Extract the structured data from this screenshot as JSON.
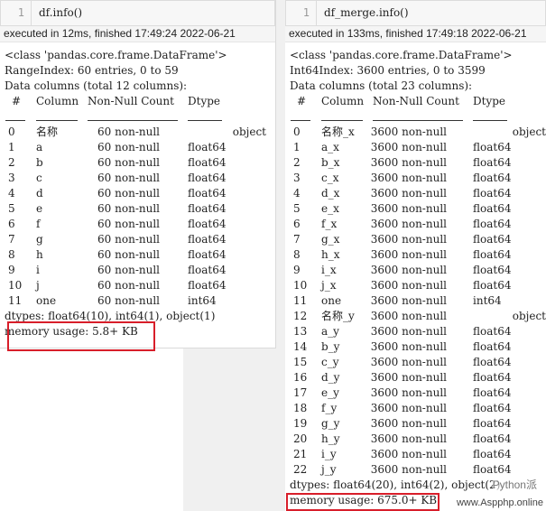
{
  "left": {
    "line_no": "1",
    "code": "df.info()",
    "status": "executed in 12ms, finished 17:49:24 2022-06-21",
    "class_line": "<class 'pandas.core.frame.DataFrame'>",
    "index_line": "RangeIndex: 60 entries, 0 to 59",
    "columns_line": "Data columns (total 12 columns):",
    "headers": {
      "num": "#",
      "column": "Column",
      "nonnull": "Non-Null Count",
      "dtype": "Dtype"
    },
    "rows": [
      {
        "num": "0",
        "name": "名称",
        "count": "60 non-null",
        "dtype": "object"
      },
      {
        "num": "1",
        "name": "a",
        "count": "60 non-null",
        "dtype": "float64"
      },
      {
        "num": "2",
        "name": "b",
        "count": "60 non-null",
        "dtype": "float64"
      },
      {
        "num": "3",
        "name": "c",
        "count": "60 non-null",
        "dtype": "float64"
      },
      {
        "num": "4",
        "name": "d",
        "count": "60 non-null",
        "dtype": "float64"
      },
      {
        "num": "5",
        "name": "e",
        "count": "60 non-null",
        "dtype": "float64"
      },
      {
        "num": "6",
        "name": "f",
        "count": "60 non-null",
        "dtype": "float64"
      },
      {
        "num": "7",
        "name": "g",
        "count": "60 non-null",
        "dtype": "float64"
      },
      {
        "num": "8",
        "name": "h",
        "count": "60 non-null",
        "dtype": "float64"
      },
      {
        "num": "9",
        "name": "i",
        "count": "60 non-null",
        "dtype": "float64"
      },
      {
        "num": "10",
        "name": "j",
        "count": "60 non-null",
        "dtype": "float64"
      },
      {
        "num": "11",
        "name": "one",
        "count": "60 non-null",
        "dtype": "int64"
      }
    ],
    "dtypes_line": "dtypes: float64(10), int64(1), object(1)",
    "memory_line": "memory usage: 5.8+ KB"
  },
  "right": {
    "line_no": "1",
    "code": "df_merge.info()",
    "status": "executed in 133ms, finished 17:49:18 2022-06-21",
    "class_line": "<class 'pandas.core.frame.DataFrame'>",
    "index_line": "Int64Index: 3600 entries, 0 to 3599",
    "columns_line": "Data columns (total 23 columns):",
    "headers": {
      "num": "#",
      "column": "Column",
      "nonnull": "Non-Null Count",
      "dtype": "Dtype"
    },
    "rows": [
      {
        "num": "0",
        "name": "名称_x",
        "count": "3600 non-null",
        "dtype": "object"
      },
      {
        "num": "1",
        "name": "a_x",
        "count": "3600 non-null",
        "dtype": "float64"
      },
      {
        "num": "2",
        "name": "b_x",
        "count": "3600 non-null",
        "dtype": "float64"
      },
      {
        "num": "3",
        "name": "c_x",
        "count": "3600 non-null",
        "dtype": "float64"
      },
      {
        "num": "4",
        "name": "d_x",
        "count": "3600 non-null",
        "dtype": "float64"
      },
      {
        "num": "5",
        "name": "e_x",
        "count": "3600 non-null",
        "dtype": "float64"
      },
      {
        "num": "6",
        "name": "f_x",
        "count": "3600 non-null",
        "dtype": "float64"
      },
      {
        "num": "7",
        "name": "g_x",
        "count": "3600 non-null",
        "dtype": "float64"
      },
      {
        "num": "8",
        "name": "h_x",
        "count": "3600 non-null",
        "dtype": "float64"
      },
      {
        "num": "9",
        "name": "i_x",
        "count": "3600 non-null",
        "dtype": "float64"
      },
      {
        "num": "10",
        "name": "j_x",
        "count": "3600 non-null",
        "dtype": "float64"
      },
      {
        "num": "11",
        "name": "one",
        "count": "3600 non-null",
        "dtype": "int64"
      },
      {
        "num": "12",
        "name": "名称_y",
        "count": "3600 non-null",
        "dtype": "object"
      },
      {
        "num": "13",
        "name": "a_y",
        "count": "3600 non-null",
        "dtype": "float64"
      },
      {
        "num": "14",
        "name": "b_y",
        "count": "3600 non-null",
        "dtype": "float64"
      },
      {
        "num": "15",
        "name": "c_y",
        "count": "3600 non-null",
        "dtype": "float64"
      },
      {
        "num": "16",
        "name": "d_y",
        "count": "3600 non-null",
        "dtype": "float64"
      },
      {
        "num": "17",
        "name": "e_y",
        "count": "3600 non-null",
        "dtype": "float64"
      },
      {
        "num": "18",
        "name": "f_y",
        "count": "3600 non-null",
        "dtype": "float64"
      },
      {
        "num": "19",
        "name": "g_y",
        "count": "3600 non-null",
        "dtype": "float64"
      },
      {
        "num": "20",
        "name": "h_y",
        "count": "3600 non-null",
        "dtype": "float64"
      },
      {
        "num": "21",
        "name": "i_y",
        "count": "3600 non-null",
        "dtype": "float64"
      },
      {
        "num": "22",
        "name": "j_y",
        "count": "3600 non-null",
        "dtype": "float64"
      }
    ],
    "dtypes_line": "dtypes: float64(20), int64(2), object(2)",
    "memory_line": "memory usage: 675.0+ KB"
  },
  "watermark": "www.Aspphp.online",
  "watermark_overlay": "Python派",
  "colors": {
    "highlight": "#d81e2a",
    "background": "#ffffff",
    "gap": "#f0f0f0"
  }
}
